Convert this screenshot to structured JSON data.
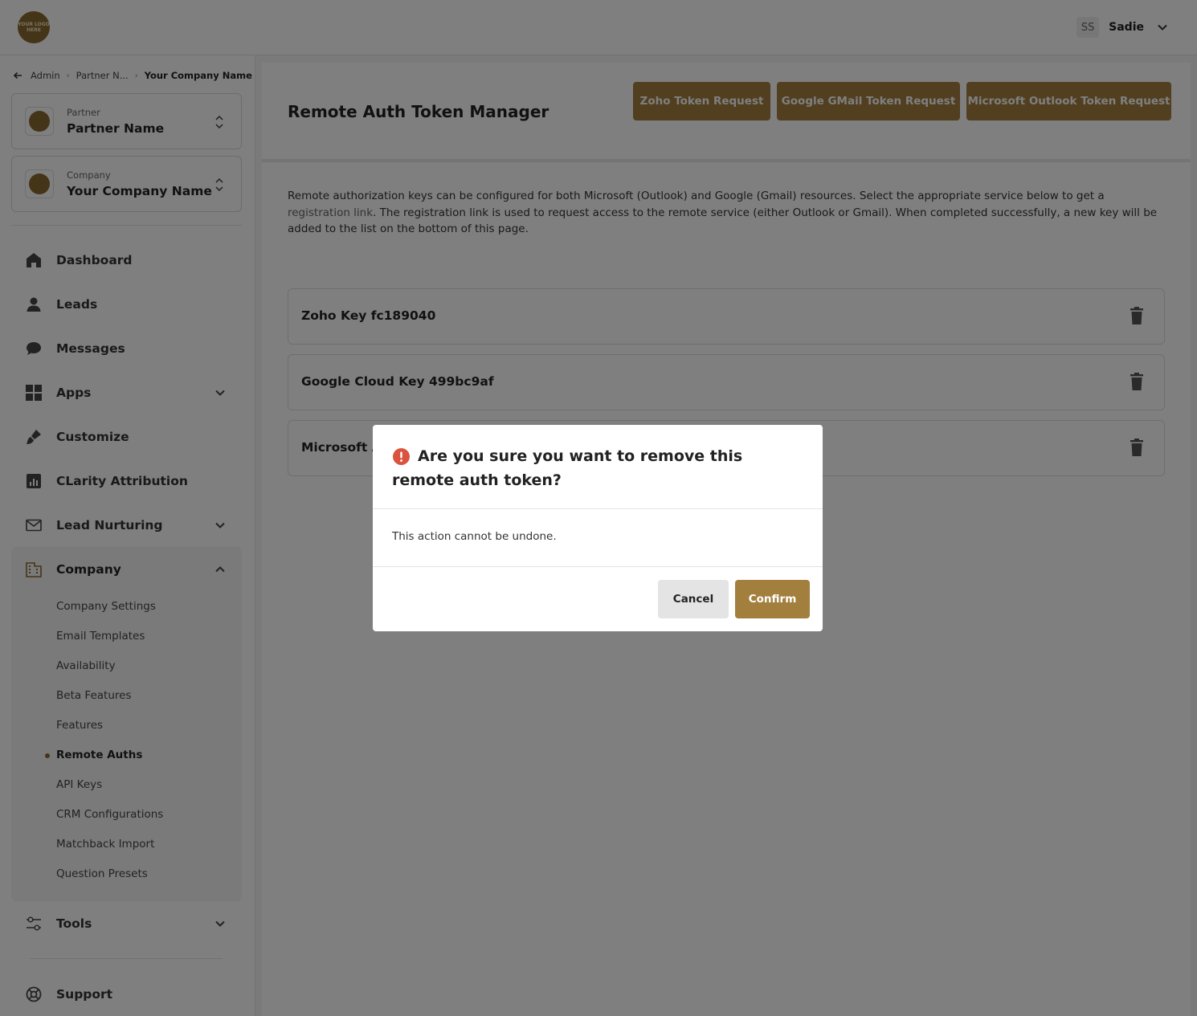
{
  "topbar": {
    "logo_text": "YOUR LOGO HERE",
    "user_initials": "SS",
    "user_name": "Sadie"
  },
  "breadcrumb": [
    "Admin",
    "Partner N...",
    "Your Company Name"
  ],
  "partner_switcher": {
    "label": "Partner",
    "name": "Partner Name"
  },
  "company_switcher": {
    "label": "Company",
    "name": "Your Company Name"
  },
  "nav": {
    "dashboard": "Dashboard",
    "leads": "Leads",
    "messages": "Messages",
    "apps": "Apps",
    "customize": "Customize",
    "clarity": "CLarity Attribution",
    "lead_nurturing": "Lead Nurturing",
    "company": "Company",
    "tools": "Tools",
    "support": "Support"
  },
  "company_sub": [
    "Company Settings",
    "Email Templates",
    "Availability",
    "Beta Features",
    "Features",
    "Remote Auths",
    "API Keys",
    "CRM Configurations",
    "Matchback Import",
    "Question Presets"
  ],
  "active_sub": "Remote Auths",
  "main": {
    "title": "Remote Auth Token Manager",
    "buttons": {
      "zoho": "Zoho Token Request",
      "google": "Google GMail Token Request",
      "microsoft": "Microsoft Outlook Token Request"
    },
    "desc_part1": "Remote authorization keys can be configured for both Microsoft (Outlook) and Google (Gmail) resources. Select the appropriate service below to get a ",
    "desc_link": "registration link",
    "desc_part2": ". The registration link is used to request access to the remote service (either Outlook or Gmail). When completed successfully, a new key will be added to the list on the bottom of this page.",
    "keys": [
      "Zoho Key fc189040",
      "Google Cloud Key 499bc9af",
      "Microsoft Az"
    ]
  },
  "modal": {
    "title": "Are you sure you want to remove this remote auth token?",
    "body": "This action cannot be undone.",
    "cancel": "Cancel",
    "confirm": "Confirm"
  },
  "colors": {
    "accent": "#a37f3e",
    "brand_logo": "#8a6a30",
    "warning": "#d9533f"
  },
  "icons": {
    "back": "arrow-left-icon",
    "dashboard": "home-icon",
    "leads": "user-icon",
    "messages": "chat-bubble-icon",
    "apps": "grid-icon",
    "customize": "paint-brush-icon",
    "clarity": "bar-chart-icon",
    "lead_nurturing": "envelope-icon",
    "company": "building-icon",
    "tools": "sliders-icon",
    "support": "lifebuoy-icon",
    "delete": "trash-icon",
    "warning": "exclamation-circle-icon"
  }
}
